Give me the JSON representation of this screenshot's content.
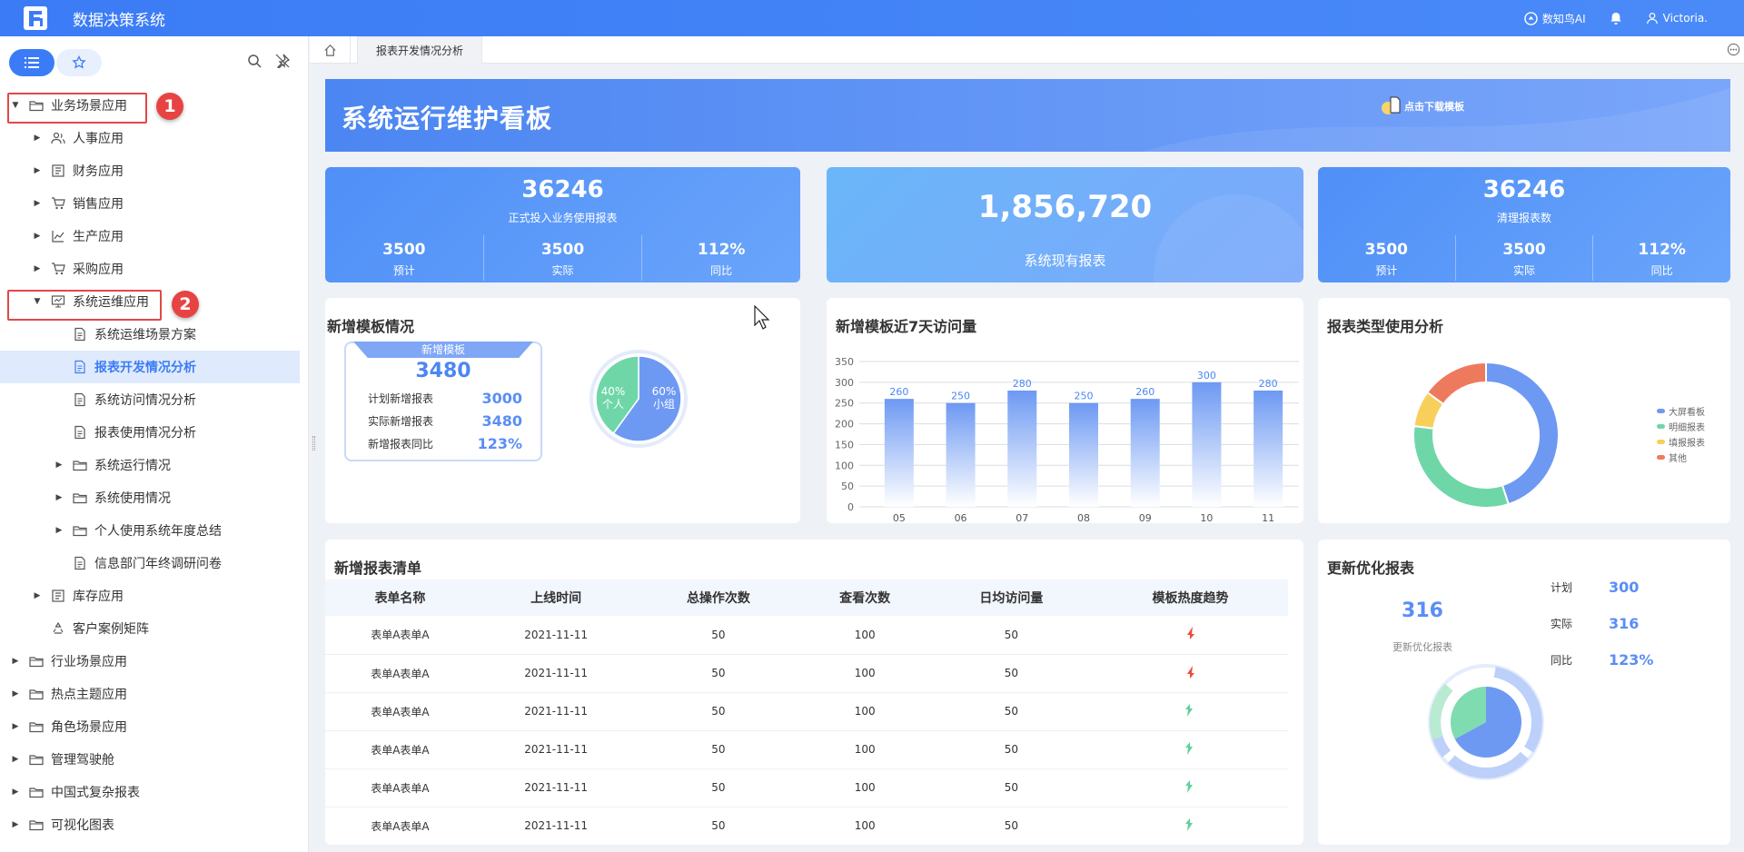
{
  "app": {
    "title": "数据决策系统"
  },
  "topbar": {
    "ai_label": "数知鸟AI",
    "user_name": "Victoria."
  },
  "sidebar": {
    "items": [
      {
        "label": "业务场景应用",
        "level": 0,
        "expanded": true,
        "icon": "folder-icon"
      },
      {
        "label": "人事应用",
        "level": 1,
        "expanded": false,
        "icon": "people-icon"
      },
      {
        "label": "财务应用",
        "level": 1,
        "expanded": false,
        "icon": "ledger-icon"
      },
      {
        "label": "销售应用",
        "level": 1,
        "expanded": false,
        "icon": "cart-icon"
      },
      {
        "label": "生产应用",
        "level": 1,
        "expanded": false,
        "icon": "chart-icon"
      },
      {
        "label": "采购应用",
        "level": 1,
        "expanded": false,
        "icon": "cart-icon"
      },
      {
        "label": "系统运维应用",
        "level": 1,
        "expanded": true,
        "icon": "monitor-icon"
      },
      {
        "label": "系统运维场景方案",
        "level": 2,
        "icon": "report-icon"
      },
      {
        "label": "报表开发情况分析",
        "level": 2,
        "icon": "report-icon",
        "active": true
      },
      {
        "label": "系统访问情况分析",
        "level": 2,
        "icon": "report-icon"
      },
      {
        "label": "报表使用情况分析",
        "level": 2,
        "icon": "report-icon"
      },
      {
        "label": "系统运行情况",
        "level": 2,
        "expanded": false,
        "icon": "folder-icon"
      },
      {
        "label": "系统使用情况",
        "level": 2,
        "expanded": false,
        "icon": "folder-icon"
      },
      {
        "label": "个人使用系统年度总结",
        "level": 2,
        "expanded": false,
        "icon": "folder-icon"
      },
      {
        "label": "信息部门年终调研问卷",
        "level": 2,
        "icon": "report-icon"
      },
      {
        "label": "库存应用",
        "level": 1,
        "expanded": false,
        "icon": "ledger-icon"
      },
      {
        "label": "客户案例矩阵",
        "level": 1,
        "icon": "recycle-icon"
      },
      {
        "label": "行业场景应用",
        "level": 0,
        "expanded": false,
        "icon": "folder-icon"
      },
      {
        "label": "热点主题应用",
        "level": 0,
        "expanded": false,
        "icon": "folder-icon"
      },
      {
        "label": "角色场景应用",
        "level": 0,
        "expanded": false,
        "icon": "folder-icon"
      },
      {
        "label": "管理驾驶舱",
        "level": 0,
        "expanded": false,
        "icon": "folder-icon"
      },
      {
        "label": "中国式复杂报表",
        "level": 0,
        "expanded": false,
        "icon": "folder-icon"
      },
      {
        "label": "可视化图表",
        "level": 0,
        "expanded": false,
        "icon": "folder-icon"
      }
    ],
    "badges": [
      "1",
      "2"
    ]
  },
  "tabs": {
    "active": "报表开发情况分析"
  },
  "dashboard": {
    "title": "系统运行维护看板",
    "download_label": "点击下载模板",
    "kpi1": {
      "value": "36246",
      "label": "正式投入业务使用报表",
      "cols": [
        {
          "v": "3500",
          "l": "预计"
        },
        {
          "v": "3500",
          "l": "实际"
        },
        {
          "v": "112%",
          "l": "同比"
        }
      ]
    },
    "kpi2": {
      "value": "1,856,720",
      "label": "系统现有报表"
    },
    "kpi3": {
      "value": "36246",
      "label": "清理报表数",
      "cols": [
        {
          "v": "3500",
          "l": "预计"
        },
        {
          "v": "3500",
          "l": "实际"
        },
        {
          "v": "112%",
          "l": "同比"
        }
      ]
    },
    "new_templates": {
      "title": "新增模板情况",
      "box_title": "新增模板",
      "total": "3480",
      "rows": [
        {
          "k": "计划新增报表",
          "v": "3000"
        },
        {
          "k": "实际新增报表",
          "v": "3480"
        },
        {
          "k": "新增报表同比",
          "v": "123%"
        }
      ],
      "pie_left_pct": "40%",
      "pie_left_label": "个人",
      "pie_right_pct": "60%",
      "pie_right_label": "小组"
    },
    "visits_title": "新增模板近7天访问量",
    "usage_title": "报表类型使用分析",
    "list": {
      "title": "新增报表清单",
      "headers": [
        "表单名称",
        "上线时间",
        "总操作次数",
        "查看次数",
        "日均访问量",
        "模板热度趋势"
      ],
      "rows": [
        {
          "name": "表单A表单A",
          "date": "2021-11-11",
          "ops": "50",
          "views": "100",
          "daily": "50",
          "trend": "down"
        },
        {
          "name": "表单A表单A",
          "date": "2021-11-11",
          "ops": "50",
          "views": "100",
          "daily": "50",
          "trend": "down"
        },
        {
          "name": "表单A表单A",
          "date": "2021-11-11",
          "ops": "50",
          "views": "100",
          "daily": "50",
          "trend": "up"
        },
        {
          "name": "表单A表单A",
          "date": "2021-11-11",
          "ops": "50",
          "views": "100",
          "daily": "50",
          "trend": "up"
        },
        {
          "name": "表单A表单A",
          "date": "2021-11-11",
          "ops": "50",
          "views": "100",
          "daily": "50",
          "trend": "up"
        },
        {
          "name": "表单A表单A",
          "date": "2021-11-11",
          "ops": "50",
          "views": "100",
          "daily": "50",
          "trend": "up"
        }
      ]
    },
    "update": {
      "title": "更新优化报表",
      "value": "316",
      "label": "更新优化报表",
      "rows": [
        {
          "k": "计划",
          "v": "300"
        },
        {
          "k": "实际",
          "v": "316"
        },
        {
          "k": "同比",
          "v": "123%"
        }
      ]
    }
  },
  "chart_data": [
    {
      "type": "bar",
      "categories": [
        "05",
        "06",
        "07",
        "08",
        "09",
        "10",
        "11"
      ],
      "values": [
        260,
        250,
        280,
        250,
        260,
        300,
        280
      ],
      "title": "新增模板近7天访问量",
      "ylim": [
        0,
        350
      ],
      "yticks": [
        "0",
        "50",
        "100",
        "150",
        "200",
        "250",
        "300",
        "350"
      ],
      "grid": true,
      "colors": {
        "bar": "#6d99f3",
        "label": "#4c86f2"
      }
    },
    {
      "type": "pie",
      "title": "新增模板情况",
      "labels": [
        "个人",
        "小组"
      ],
      "values": [
        40,
        60
      ],
      "colors": [
        "#6fd6a8",
        "#6d99f3"
      ]
    },
    {
      "type": "pie",
      "title": "报表类型使用分析",
      "labels": [
        "大屏看板",
        "明细报表",
        "填报报表",
        "其他"
      ],
      "values": [
        45,
        32,
        8,
        15
      ],
      "colors": [
        "#6d99f3",
        "#6fd6a8",
        "#f7cf5a",
        "#ee7a5e"
      ],
      "legend": "right"
    }
  ],
  "colors": {
    "accent": "#3b7cf6",
    "down": "#f04a3a",
    "up": "#5fcf9b"
  }
}
